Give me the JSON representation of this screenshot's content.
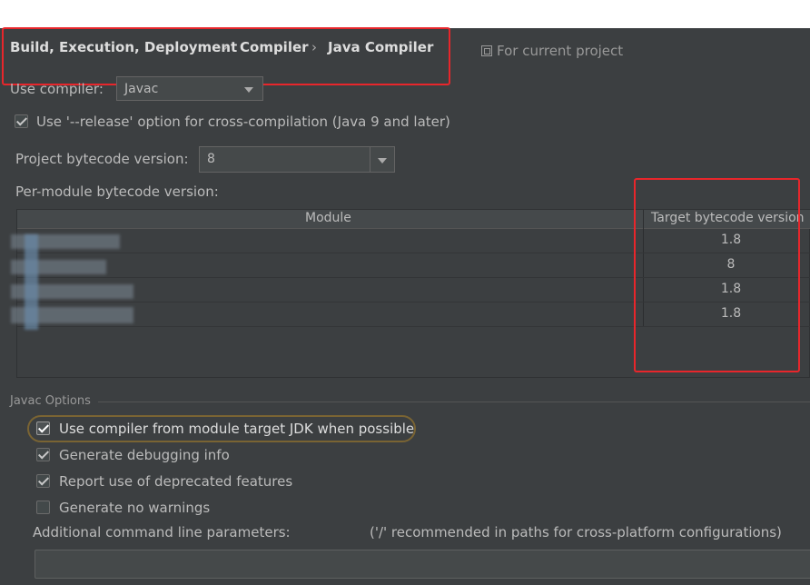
{
  "breadcrumb": [
    "Build, Execution, Deployment",
    "Compiler",
    "Java Compiler"
  ],
  "breadcrumb_separator": "›",
  "scope_label": "For current project",
  "use_compiler": {
    "label": "Use compiler:",
    "value": "Javac"
  },
  "release_option": {
    "label": "Use '--release' option for cross-compilation (Java 9 and later)",
    "checked": true
  },
  "project_bytecode": {
    "label": "Project bytecode version:",
    "value": "8"
  },
  "per_module_label": "Per-module bytecode version:",
  "table": {
    "columns": [
      "Module",
      "Target bytecode version"
    ],
    "rows": [
      {
        "module": "",
        "target": "1.8"
      },
      {
        "module": "",
        "target": "8"
      },
      {
        "module": "",
        "target": "1.8"
      },
      {
        "module": "",
        "target": "1.8"
      }
    ]
  },
  "javac_options": {
    "title": "Javac Options",
    "items": [
      {
        "label": "Use compiler from module target JDK when possible",
        "checked": true
      },
      {
        "label": "Generate debugging info",
        "checked": true
      },
      {
        "label": "Report use of deprecated features",
        "checked": true
      },
      {
        "label": "Generate no warnings",
        "checked": false
      }
    ]
  },
  "additional_params": {
    "label": "Additional command line parameters:",
    "hint": "('/' recommended in paths for cross-platform configurations)",
    "value": ""
  },
  "colors": {
    "panel_bg": "#3c3f41",
    "highlight_red": "#e8262b",
    "highlight_gold": "#7a6433"
  }
}
